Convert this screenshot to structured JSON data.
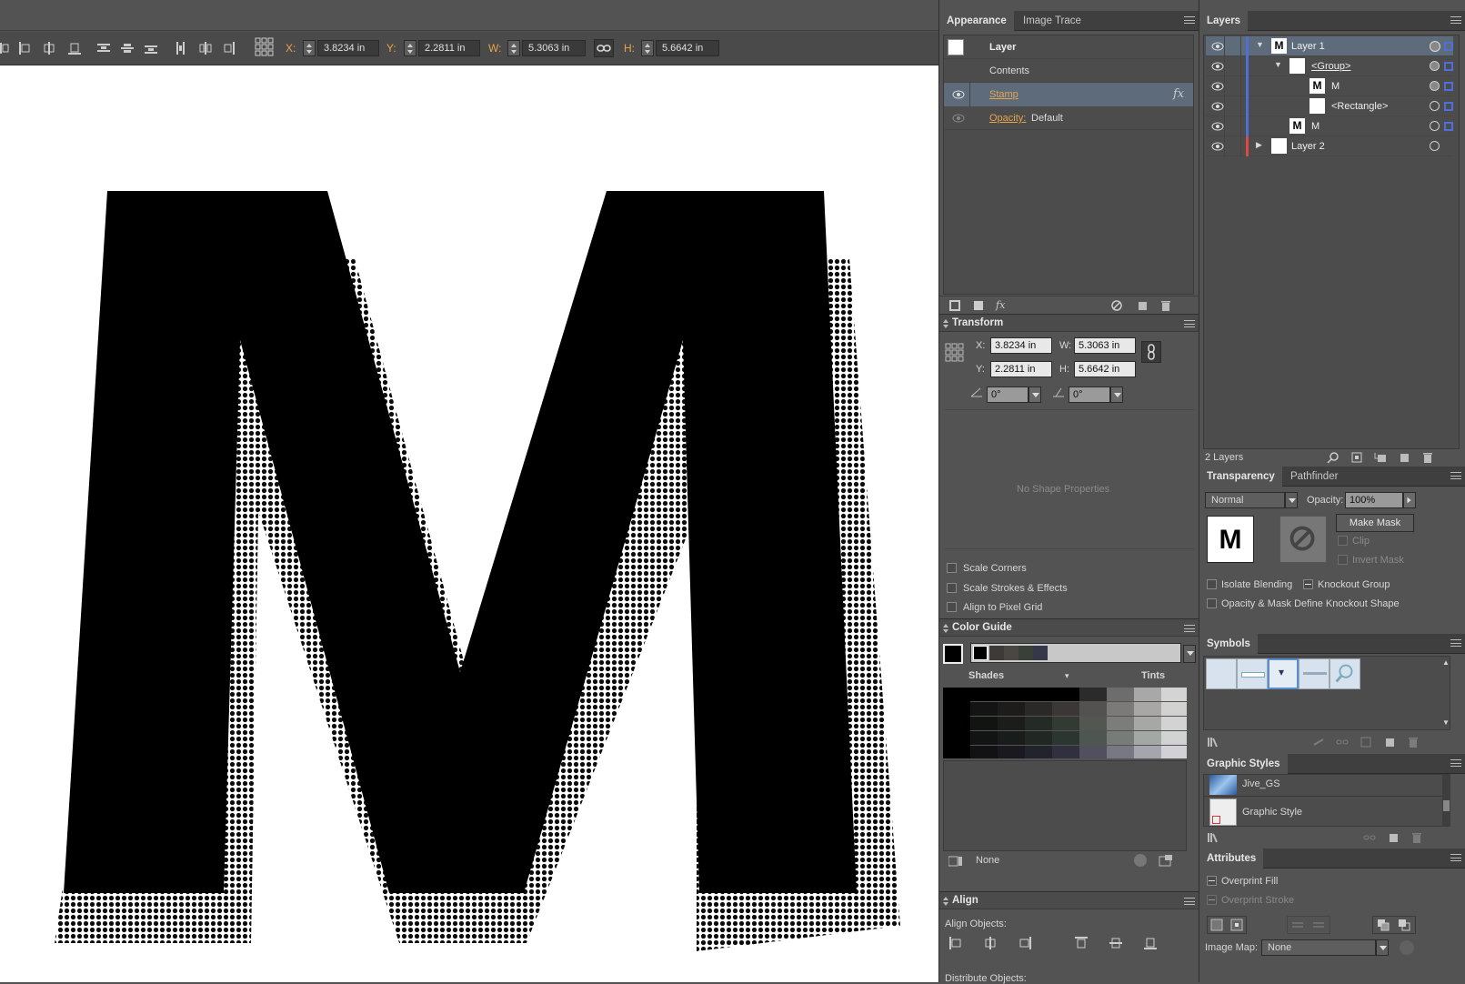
{
  "control_bar": {
    "x_label": "X:",
    "x_value": "3.8234 in",
    "y_label": "Y:",
    "y_value": "2.2811 in",
    "w_label": "W:",
    "w_value": "5.3063 in",
    "h_label": "H:",
    "h_value": "5.6642 in"
  },
  "canvas": {
    "letter": "M"
  },
  "appearance": {
    "tabs": [
      "Appearance",
      "Image Trace"
    ],
    "rows": {
      "layer": "Layer",
      "contents": "Contents",
      "stamp": "Stamp",
      "fx": "fx",
      "opacity_label": "Opacity:",
      "opacity_value": "Default"
    }
  },
  "transform": {
    "title": "Transform",
    "x_label": "X:",
    "x_value": "3.8234 in",
    "y_label": "Y:",
    "y_value": "2.2811 in",
    "w_label": "W:",
    "w_value": "5.3063 in",
    "h_label": "H:",
    "h_value": "5.6642 in",
    "rotate_value": "0°",
    "shear_value": "0°",
    "no_shape": "No Shape Properties",
    "options": [
      "Scale Corners",
      "Scale Strokes & Effects",
      "Align to Pixel Grid"
    ]
  },
  "color_guide": {
    "title": "Color Guide",
    "shades_label": "Shades",
    "tints_label": "Tints",
    "none_label": "None"
  },
  "align": {
    "title": "Align",
    "align_objects": "Align Objects:",
    "distribute_objects": "Distribute Objects:"
  },
  "layers": {
    "tab": "Layers",
    "rows": [
      {
        "name": "Layer 1",
        "letter": "M"
      },
      {
        "name": "<Group>"
      },
      {
        "name": "M",
        "letter": "M"
      },
      {
        "name": "<Rectangle>"
      },
      {
        "name": "M",
        "letter": "M"
      },
      {
        "name": "Layer 2"
      }
    ],
    "count": "2 Layers"
  },
  "transparency": {
    "tabs": [
      "Transparency",
      "Pathfinder"
    ],
    "blend_mode": "Normal",
    "opacity_label": "Opacity:",
    "opacity_value": "100%",
    "thumb_letter": "M",
    "make_mask": "Make Mask",
    "clip": "Clip",
    "invert_mask": "Invert Mask",
    "isolate": "Isolate Blending",
    "knockout": "Knockout Group",
    "opacity_mask": "Opacity & Mask Define Knockout Shape"
  },
  "symbols": {
    "title": "Symbols"
  },
  "graphic_styles": {
    "title": "Graphic Styles",
    "items": [
      "Jive_GS",
      "Graphic Style"
    ]
  },
  "attributes": {
    "title": "Attributes",
    "overprint_fill": "Overprint Fill",
    "overprint_stroke": "Overprint Stroke",
    "image_map_label": "Image Map:",
    "image_map_value": "None"
  },
  "colors": {
    "selection": "#5d6b7b",
    "accent_orange": "#e8a34a",
    "layer1_color": "#4f6fd8",
    "layer2_color": "#e04848"
  }
}
